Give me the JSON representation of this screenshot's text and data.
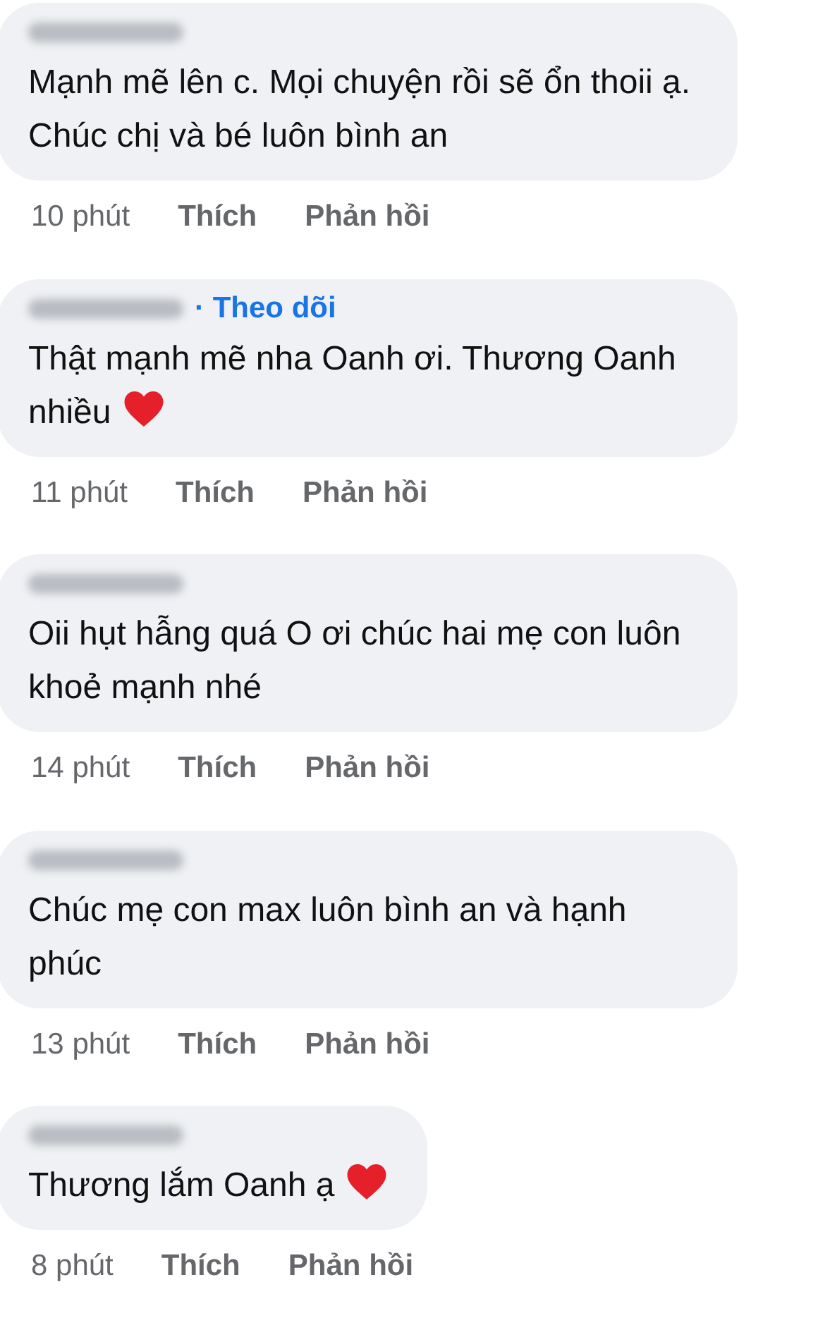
{
  "comments": [
    {
      "text": "Mạnh mẽ lên c. Mọi chuyện rồi sẽ ổn thoii ạ. Chúc chị và bé luôn bình an",
      "heart": false,
      "time": "10 phút",
      "like": "Thích",
      "reply": "Phản hồi"
    },
    {
      "follow": "· Theo dõi",
      "text": "Thật mạnh mẽ nha Oanh ơi. Thương Oanh nhiều",
      "heart": true,
      "time": "11 phút",
      "like": "Thích",
      "reply": "Phản hồi"
    },
    {
      "text": "Oii hụt hẫng quá O ơi chúc hai mẹ con luôn khoẻ mạnh nhé",
      "heart": false,
      "time": "14 phút",
      "like": "Thích",
      "reply": "Phản hồi"
    },
    {
      "text": "Chúc mẹ con max luôn bình an và hạnh phúc",
      "heart": false,
      "time": "13 phút",
      "like": "Thích",
      "reply": "Phản hồi"
    },
    {
      "text": "Thương lắm Oanh ạ",
      "heart": true,
      "time": "8 phút",
      "like": "Thích",
      "reply": "Phản hồi"
    }
  ]
}
